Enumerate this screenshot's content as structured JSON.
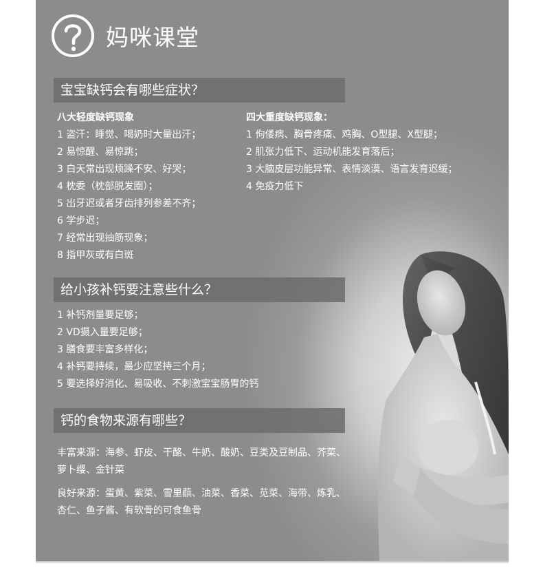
{
  "header": {
    "title": "妈咪课堂",
    "icon": "question-circle-icon"
  },
  "section1": {
    "heading": "宝宝缺钙会有哪些症状？",
    "left": {
      "title": "八大轻度缺钙现象",
      "items": [
        "1 盗汗：睡觉、喝奶时大量出汗；",
        "2 易惊醒、易惊跳；",
        "3 白天常出现烦躁不安、好哭；",
        "4 枕委（枕部脱发圈）；",
        "5 出牙迟或者牙齿排列参差不齐；",
        "6 学步迟；",
        "7 经常出现抽筋现象；",
        "8 指甲灰或有白斑"
      ]
    },
    "right": {
      "title": "四大重度缺钙现象：",
      "items": [
        "1 佝偻病、胸骨疼痛、鸡胸、O型腿、X型腿；",
        "2 肌张力低下、运动机能发育落后；",
        "3 大脑皮层功能异常、表情淡漠、语言发育迟缓；",
        "4 免疫力低下"
      ]
    }
  },
  "section2": {
    "heading": "给小孩补钙要注意些什么？",
    "items": [
      "1 补钙剂量要足够；",
      "2 VD摄入量要足够；",
      "3 膳食要丰富多样化；",
      "4 补钙要持续，最少应坚持三个月；",
      "5 要选择好消化、易吸收、不刺激宝宝肠胃的钙"
    ]
  },
  "section3": {
    "heading": "钙的食物来源有哪些？",
    "rich": "丰富来源：海参、虾皮、干酪、牛奶、酸奶、豆类及豆制品、芥菜、萝卜缨、金针菜",
    "good": "良好来源：蛋黄、紫菜、雪里蕻、油菜、香菜、苋菜、海带、炼乳、杏仁、鱼子酱、有软骨的可食鱼骨"
  },
  "colors": {
    "panel": "#8e8e8e",
    "bar": "#6c6c6c",
    "text": "#ffffff"
  }
}
